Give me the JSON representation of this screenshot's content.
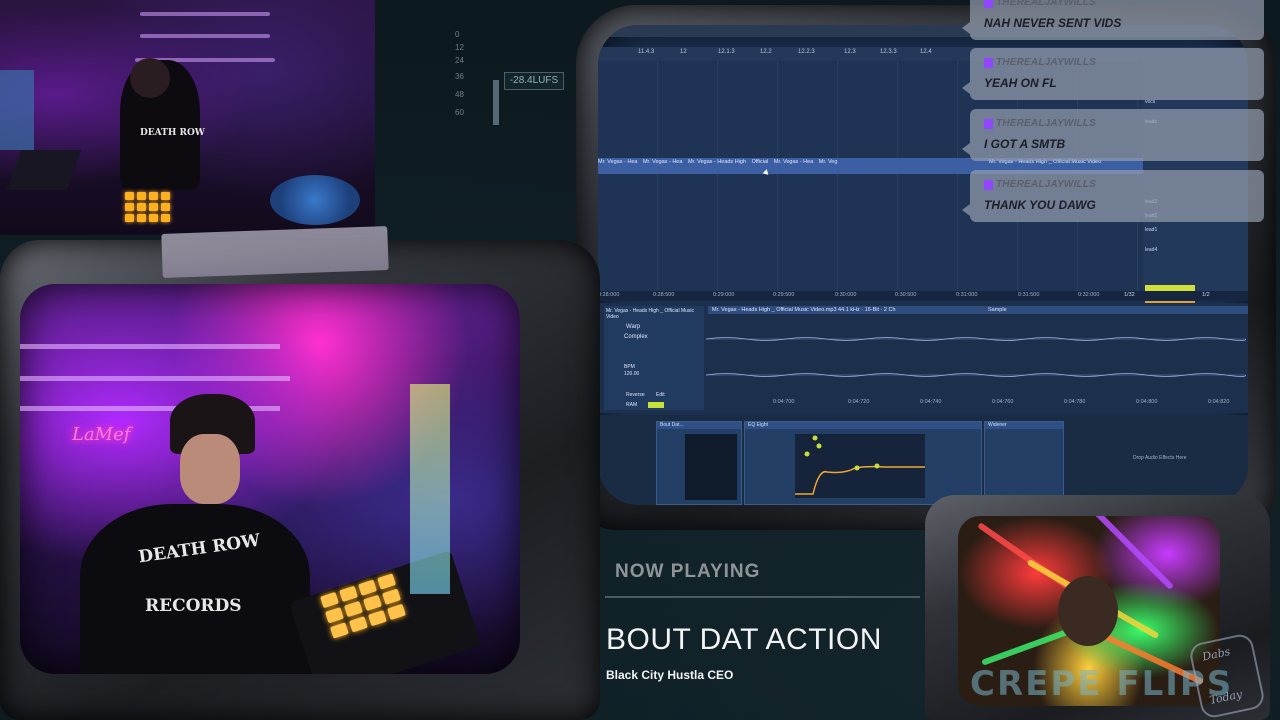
{
  "meter": {
    "ticks": [
      "0",
      "12",
      "24",
      "36",
      "48",
      "60"
    ],
    "lufs": "-28.4LUFS"
  },
  "chat": [
    {
      "user": "THEREALJAYWILLS",
      "message": "NAH NEVER SENT VIDS"
    },
    {
      "user": "THEREALJAYWILLS",
      "message": "YEAH ON FL"
    },
    {
      "user": "THEREALJAYWILLS",
      "message": "I GOT A SMTB"
    },
    {
      "user": "THEREALJAYWILLS",
      "message": "THANK YOU DAWG"
    }
  ],
  "daw": {
    "ruler_ticks": [
      "11.4.3",
      "12",
      "12.1.3",
      "12.2",
      "12.2.3",
      "12.3",
      "12.3.3",
      "12.4"
    ],
    "clip_label": "Mr. Vegas - Heads High _ Official Music Video",
    "clip_short": [
      "Mr. Vegas - Hea",
      "Mr. Vegas - Hea",
      "Mr. Vegas - Heads High",
      "Official",
      "Mr. Vegas - Hea",
      "Mr. Veg"
    ],
    "tracks": [
      "vocs",
      "leads",
      "lead3",
      "lead2",
      "lead1",
      "lead4"
    ],
    "time_ticks": [
      "0:28:000",
      "0:28:500",
      "0:29:000",
      "0:29:500",
      "0:30:000",
      "0:30:500",
      "0:31:000",
      "0:31:500",
      "0:32:000"
    ],
    "clip_title": "Mr. Vegas - Heads High _ Official Music Video.mp3  44.1 kHz · 16-Bit · 2 Ch",
    "clip_name_short": "Mr. Vegas - Heads High _ Official Music Video",
    "sample_label": "Sample",
    "warp": "Warp",
    "mode": "Complex",
    "bpm_label": "BPM",
    "bpm": "120.00",
    "reverse": "Reverse",
    "edit": "Edit",
    "ram": "RAM",
    "wave_ticks": [
      "0:04:700",
      "0:04:720",
      "0:04:740",
      "0:04:760",
      "0:04:780",
      "0:04:800",
      "0:04:820"
    ],
    "devices": [
      "Bout Dat...",
      "EQ Eight",
      "Widener"
    ],
    "drop_text": "Drop Audio Effects Here",
    "quantize": "1/32",
    "page": "1/2"
  },
  "now_playing": {
    "label": "NOW PLAYING",
    "title": "BOUT DAT ACTION",
    "artist": "Black City Hustla CEO"
  },
  "overlay": {
    "crepe": "CREPE FLIPS",
    "badge_top": "Dabs",
    "badge_bottom": "Today"
  },
  "shirt": {
    "top": "DEATH ROW",
    "bottom": "RECORDS"
  },
  "neon_sign": "LaMef",
  "colors": {
    "twitch": "#9147ff",
    "daw_bg": "#1f3454",
    "clip": "#3c5fa3",
    "pad": "#ffb020"
  }
}
